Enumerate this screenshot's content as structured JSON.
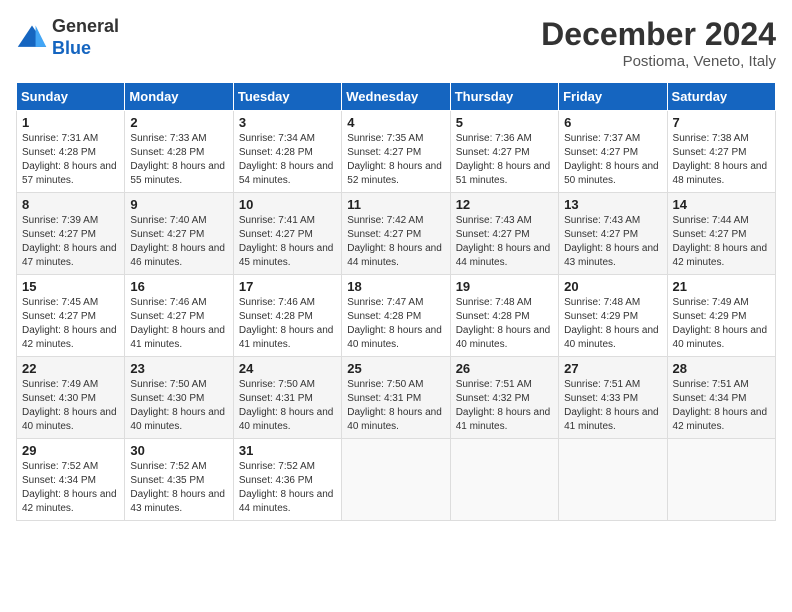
{
  "header": {
    "logo_line1": "General",
    "logo_line2": "Blue",
    "title": "December 2024",
    "subtitle": "Postioma, Veneto, Italy"
  },
  "days_of_week": [
    "Sunday",
    "Monday",
    "Tuesday",
    "Wednesday",
    "Thursday",
    "Friday",
    "Saturday"
  ],
  "weeks": [
    [
      {
        "day": 1,
        "sunrise": "7:31 AM",
        "sunset": "4:28 PM",
        "daylight": "8 hours and 57 minutes."
      },
      {
        "day": 2,
        "sunrise": "7:33 AM",
        "sunset": "4:28 PM",
        "daylight": "8 hours and 55 minutes."
      },
      {
        "day": 3,
        "sunrise": "7:34 AM",
        "sunset": "4:28 PM",
        "daylight": "8 hours and 54 minutes."
      },
      {
        "day": 4,
        "sunrise": "7:35 AM",
        "sunset": "4:27 PM",
        "daylight": "8 hours and 52 minutes."
      },
      {
        "day": 5,
        "sunrise": "7:36 AM",
        "sunset": "4:27 PM",
        "daylight": "8 hours and 51 minutes."
      },
      {
        "day": 6,
        "sunrise": "7:37 AM",
        "sunset": "4:27 PM",
        "daylight": "8 hours and 50 minutes."
      },
      {
        "day": 7,
        "sunrise": "7:38 AM",
        "sunset": "4:27 PM",
        "daylight": "8 hours and 48 minutes."
      }
    ],
    [
      {
        "day": 8,
        "sunrise": "7:39 AM",
        "sunset": "4:27 PM",
        "daylight": "8 hours and 47 minutes."
      },
      {
        "day": 9,
        "sunrise": "7:40 AM",
        "sunset": "4:27 PM",
        "daylight": "8 hours and 46 minutes."
      },
      {
        "day": 10,
        "sunrise": "7:41 AM",
        "sunset": "4:27 PM",
        "daylight": "8 hours and 45 minutes."
      },
      {
        "day": 11,
        "sunrise": "7:42 AM",
        "sunset": "4:27 PM",
        "daylight": "8 hours and 44 minutes."
      },
      {
        "day": 12,
        "sunrise": "7:43 AM",
        "sunset": "4:27 PM",
        "daylight": "8 hours and 44 minutes."
      },
      {
        "day": 13,
        "sunrise": "7:43 AM",
        "sunset": "4:27 PM",
        "daylight": "8 hours and 43 minutes."
      },
      {
        "day": 14,
        "sunrise": "7:44 AM",
        "sunset": "4:27 PM",
        "daylight": "8 hours and 42 minutes."
      }
    ],
    [
      {
        "day": 15,
        "sunrise": "7:45 AM",
        "sunset": "4:27 PM",
        "daylight": "8 hours and 42 minutes."
      },
      {
        "day": 16,
        "sunrise": "7:46 AM",
        "sunset": "4:27 PM",
        "daylight": "8 hours and 41 minutes."
      },
      {
        "day": 17,
        "sunrise": "7:46 AM",
        "sunset": "4:28 PM",
        "daylight": "8 hours and 41 minutes."
      },
      {
        "day": 18,
        "sunrise": "7:47 AM",
        "sunset": "4:28 PM",
        "daylight": "8 hours and 40 minutes."
      },
      {
        "day": 19,
        "sunrise": "7:48 AM",
        "sunset": "4:28 PM",
        "daylight": "8 hours and 40 minutes."
      },
      {
        "day": 20,
        "sunrise": "7:48 AM",
        "sunset": "4:29 PM",
        "daylight": "8 hours and 40 minutes."
      },
      {
        "day": 21,
        "sunrise": "7:49 AM",
        "sunset": "4:29 PM",
        "daylight": "8 hours and 40 minutes."
      }
    ],
    [
      {
        "day": 22,
        "sunrise": "7:49 AM",
        "sunset": "4:30 PM",
        "daylight": "8 hours and 40 minutes."
      },
      {
        "day": 23,
        "sunrise": "7:50 AM",
        "sunset": "4:30 PM",
        "daylight": "8 hours and 40 minutes."
      },
      {
        "day": 24,
        "sunrise": "7:50 AM",
        "sunset": "4:31 PM",
        "daylight": "8 hours and 40 minutes."
      },
      {
        "day": 25,
        "sunrise": "7:50 AM",
        "sunset": "4:31 PM",
        "daylight": "8 hours and 40 minutes."
      },
      {
        "day": 26,
        "sunrise": "7:51 AM",
        "sunset": "4:32 PM",
        "daylight": "8 hours and 41 minutes."
      },
      {
        "day": 27,
        "sunrise": "7:51 AM",
        "sunset": "4:33 PM",
        "daylight": "8 hours and 41 minutes."
      },
      {
        "day": 28,
        "sunrise": "7:51 AM",
        "sunset": "4:34 PM",
        "daylight": "8 hours and 42 minutes."
      }
    ],
    [
      {
        "day": 29,
        "sunrise": "7:52 AM",
        "sunset": "4:34 PM",
        "daylight": "8 hours and 42 minutes."
      },
      {
        "day": 30,
        "sunrise": "7:52 AM",
        "sunset": "4:35 PM",
        "daylight": "8 hours and 43 minutes."
      },
      {
        "day": 31,
        "sunrise": "7:52 AM",
        "sunset": "4:36 PM",
        "daylight": "8 hours and 44 minutes."
      },
      null,
      null,
      null,
      null
    ]
  ]
}
